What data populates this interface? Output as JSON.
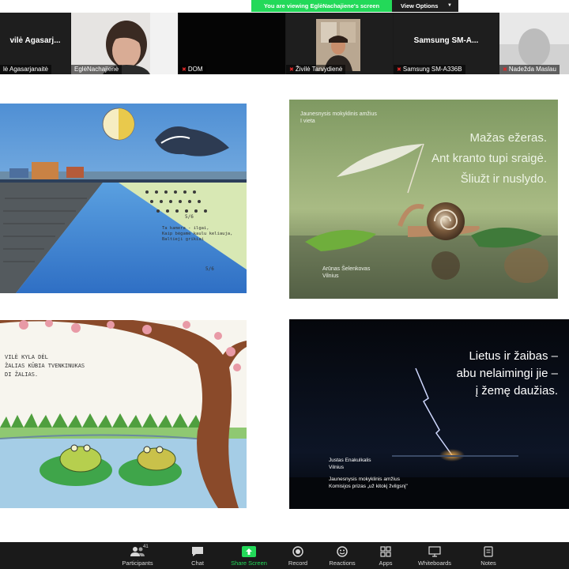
{
  "banner": {
    "viewing_text": "You are viewing EglėNachajiene's screen",
    "view_options_label": "View Options"
  },
  "participants": [
    {
      "big_name": "vilė Agasarj...",
      "label": "lė Agasarjanaitė",
      "muted": false
    },
    {
      "big_name": "",
      "label": "EglėNachajienė",
      "muted": false
    },
    {
      "big_name": "",
      "label": "DOM",
      "muted": true
    },
    {
      "big_name": "",
      "label": "Živilė Tarvydienė",
      "muted": true
    },
    {
      "big_name": "Samsung SM-A...",
      "label": "Samsung SM-A336B",
      "muted": true
    },
    {
      "big_name": "",
      "label": "Nadežda Maslau",
      "muted": true
    }
  ],
  "slides": {
    "slide1": {
      "drawing_text": [
        "Ta kamera - ilgai,",
        "Kaip bėgame kaulu keliauja,",
        "Baltieji grikiai"
      ],
      "num_a": "5/6",
      "num_b": "5/6"
    },
    "slide2": {
      "top_note": [
        "Jaunesnysis mokyklinis amžius",
        "I vieta"
      ],
      "haiku": [
        "Mažas ežeras.",
        "Ant kranto tupi sraigė.",
        "Šliužt ir nuslydo."
      ],
      "credit": [
        "Arūnas Šelenkovas",
        "Vilnius"
      ]
    },
    "slide3": {
      "drawing_text": [
        "VILĖ KYLA DĖL",
        "ŽALIAS KŪBIA TVENKINUKAS",
        "DI ŽALIAS."
      ]
    },
    "slide4": {
      "haiku": [
        "Lietus ir žaibas –",
        "abu nelaimingi jie –",
        "į žemę daužias."
      ],
      "credit_name": [
        "Justas Enakulkalis",
        "Vilnius"
      ],
      "credit_prize": [
        "Jaunesnysis mokyklinis amžius",
        "Komisijos prizas „už kitokį žvilgsnį\""
      ]
    }
  },
  "toolbar": {
    "participants_label": "Participants",
    "participants_count": "41",
    "chat_label": "Chat",
    "share_label": "Share Screen",
    "record_label": "Record",
    "reactions_label": "Reactions",
    "apps_label": "Apps",
    "whiteboards_label": "Whiteboards",
    "notes_label": "Notes"
  },
  "colors": {
    "banner_green": "#23d959",
    "toolbar_bg": "#1a1a1a",
    "mic_muted": "#e02828"
  }
}
